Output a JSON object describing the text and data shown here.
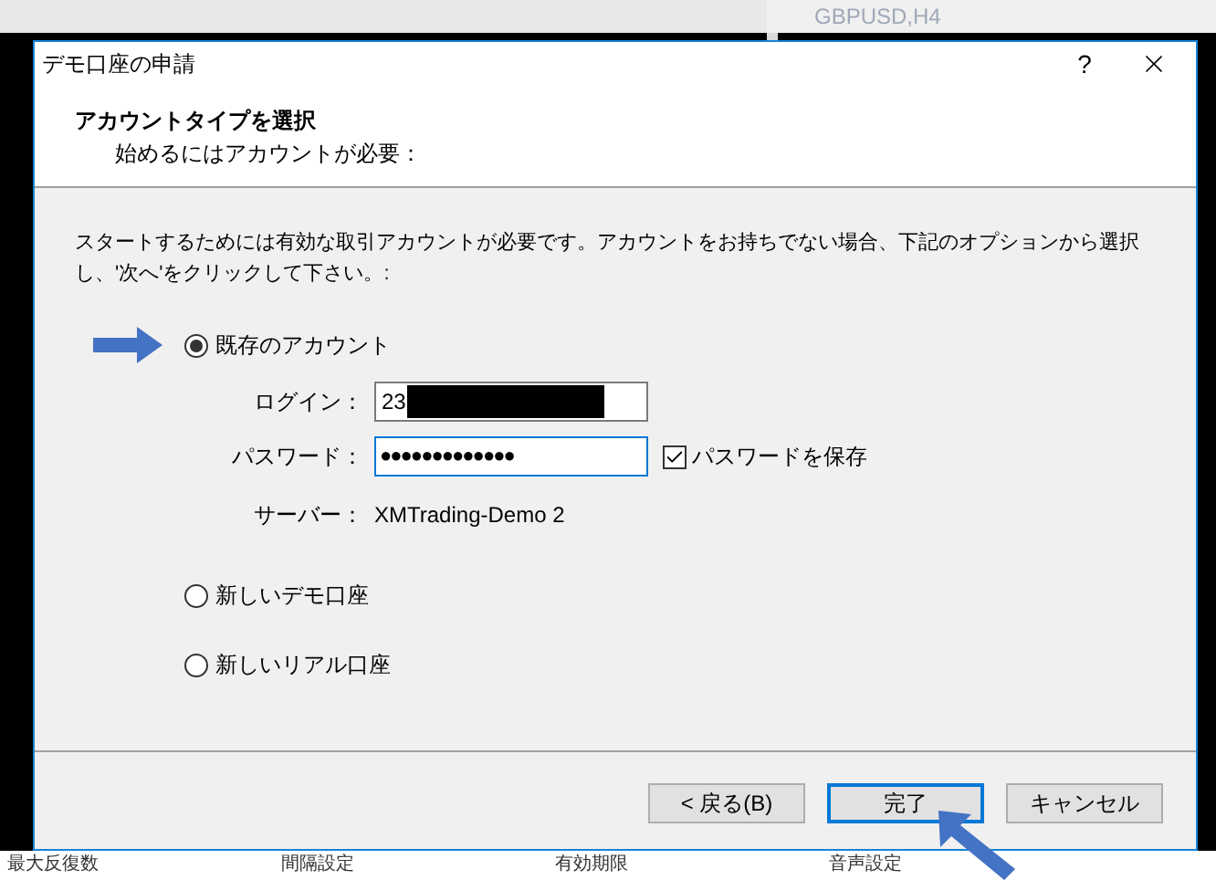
{
  "background": {
    "chart_title": "GBPUSD,H4",
    "bottom_labels": [
      "最大反復数",
      "間隔設定",
      "有効期限",
      "音声設定"
    ]
  },
  "dialog": {
    "title": "デモ口座の申請",
    "help": "?",
    "header": {
      "title": "アカウントタイプを選択",
      "subtitle": "始めるにはアカウントが必要："
    },
    "intro": "スタートするためには有効な取引アカウントが必要です。アカウントをお持ちでない場合、下記のオプションから選択し、'次へ'をクリックして下さい。:",
    "options": [
      {
        "label": "既存のアカウント",
        "selected": true
      },
      {
        "label": "新しいデモ口座",
        "selected": false
      },
      {
        "label": "新しいリアル口座",
        "selected": false
      }
    ],
    "login": {
      "label": "ログイン：",
      "value": "23"
    },
    "password": {
      "label": "パスワード：",
      "value": "●●●●●●●●●●●●●"
    },
    "save_password": {
      "label": "パスワードを保存",
      "checked": true
    },
    "server": {
      "label": "サーバー：",
      "value": "XMTrading-Demo 2"
    },
    "buttons": [
      {
        "label": "< 戻る(B)",
        "default": false
      },
      {
        "label": "完了",
        "default": true
      },
      {
        "label": "キャンセル",
        "default": false
      }
    ]
  }
}
